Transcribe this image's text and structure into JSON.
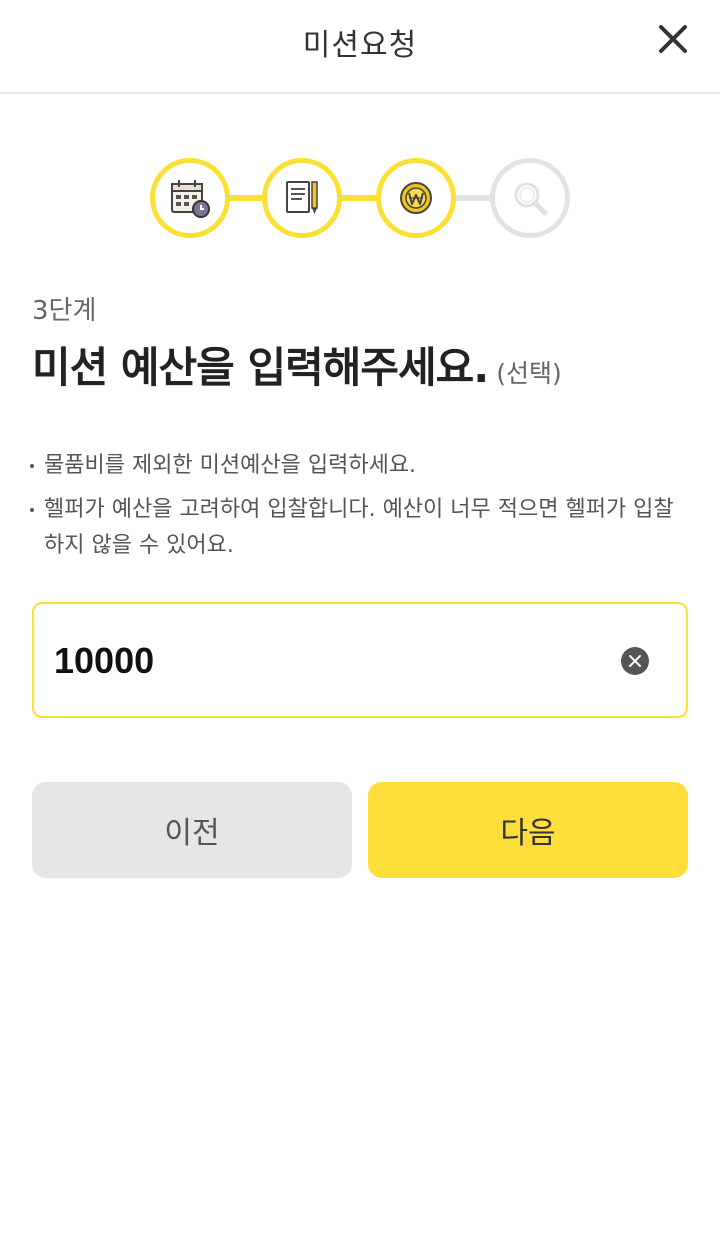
{
  "header": {
    "title": "미션요청",
    "close_icon": "close-icon"
  },
  "stepper": {
    "active_color": "#fde035",
    "inactive_color": "#e3e3e3",
    "current_step": 3,
    "total_steps": 4,
    "steps": [
      {
        "icon": "calendar-clock-icon",
        "state": "done"
      },
      {
        "icon": "document-pencil-icon",
        "state": "done"
      },
      {
        "icon": "won-coin-icon",
        "state": "active"
      },
      {
        "icon": "magnifier-icon",
        "state": "inactive"
      }
    ]
  },
  "content": {
    "step_label": "3단계",
    "headline": "미션 예산을 입력해주세요.",
    "optional_label": "(선택)",
    "notes": [
      "물품비를 제외한 미션예산을 입력하세요.",
      "헬퍼가 예산을 고려하여 입찰합니다. 예산이 너무 적으면 헬퍼가 입찰하지 않을 수 있어요."
    ]
  },
  "budget_input": {
    "value": "10000",
    "clear_icon": "clear-circle-icon"
  },
  "buttons": {
    "prev_label": "이전",
    "next_label": "다음",
    "next_color": "#fdde3a",
    "prev_color": "#e6e6e6"
  }
}
